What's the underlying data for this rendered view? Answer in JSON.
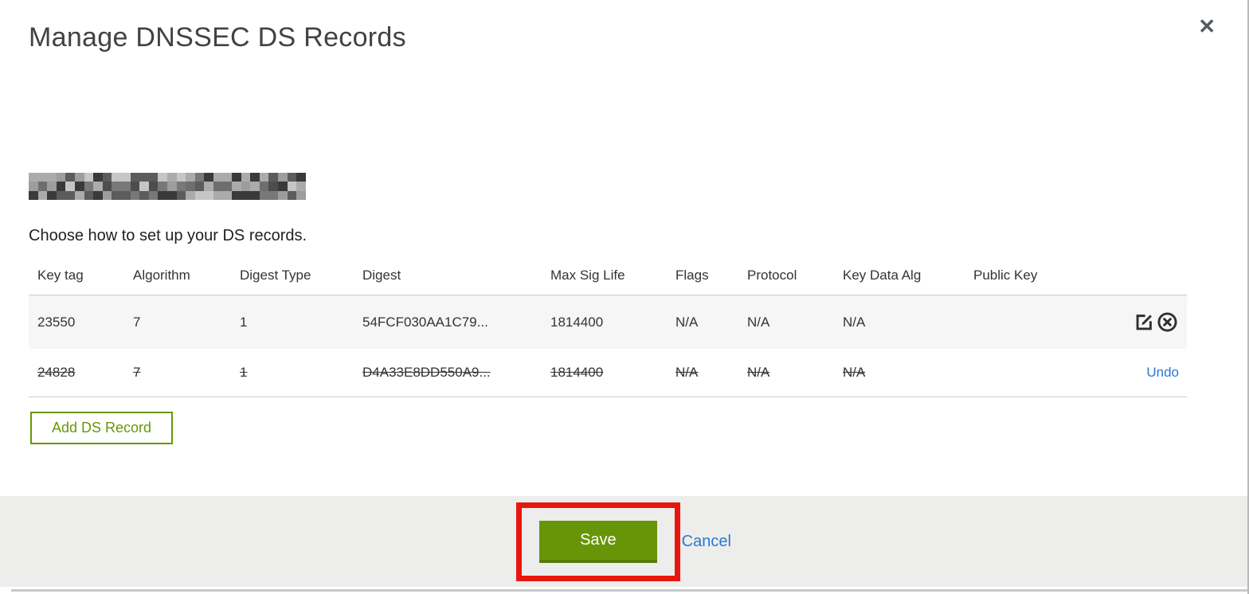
{
  "modal": {
    "title": "Manage DNSSEC DS Records",
    "close_icon": "✕",
    "instruction": "Choose how to set up your DS records.",
    "add_record_label": "Add DS Record",
    "save_label": "Save",
    "cancel_label": "Cancel"
  },
  "table": {
    "headers": [
      "Key tag",
      "Algorithm",
      "Digest Type",
      "Digest",
      "Max Sig Life",
      "Flags",
      "Protocol",
      "Key Data Alg",
      "Public Key"
    ],
    "rows": [
      {
        "key_tag": "23550",
        "algorithm": "7",
        "digest_type": "1",
        "digest": "54FCF030AA1C79...",
        "max_sig_life": "1814400",
        "flags": "N/A",
        "protocol": "N/A",
        "key_data_alg": "N/A",
        "public_key": "",
        "state": "active"
      },
      {
        "key_tag": "24828",
        "algorithm": "7",
        "digest_type": "1",
        "digest": "D4A33E8DD550A9...",
        "max_sig_life": "1814400",
        "flags": "N/A",
        "protocol": "N/A",
        "key_data_alg": "N/A",
        "public_key": "",
        "state": "pending-delete",
        "undo_label": "Undo"
      }
    ]
  },
  "colors": {
    "accent_green": "#699607",
    "save_button_green": "#679508",
    "link_blue": "#2a77d4",
    "annotation_red": "#e8170d",
    "footer_background": "#ededeb",
    "row_stripe": "#f6f6f6"
  }
}
